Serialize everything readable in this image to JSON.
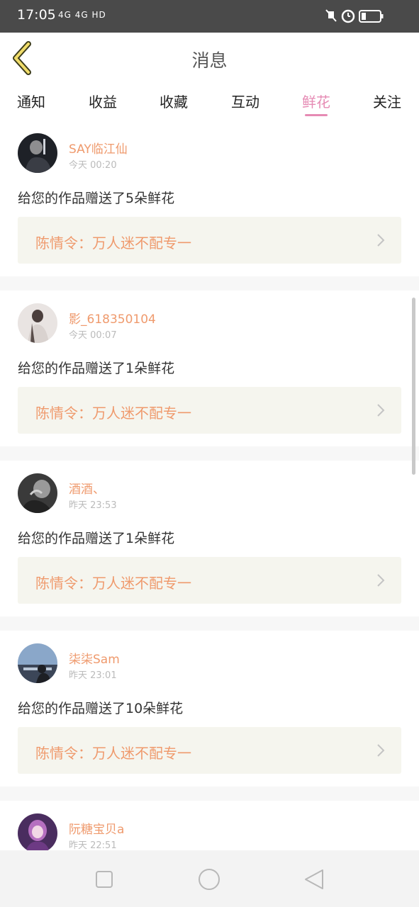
{
  "status": {
    "time": "17:05",
    "network": "4G 4G HD"
  },
  "header": {
    "title": "消息"
  },
  "tabs": [
    {
      "label": "通知"
    },
    {
      "label": "收益"
    },
    {
      "label": "收藏"
    },
    {
      "label": "互动"
    },
    {
      "label": "鲜花",
      "active": true
    },
    {
      "label": "关注"
    }
  ],
  "colors": {
    "accent": "#e68bb4",
    "name": "#ef9a6d",
    "link_bg": "#f5f5ee"
  },
  "items": [
    {
      "name": "SAY临江仙",
      "time": "今天 00:20",
      "message": "给您的作品赠送了5朵鲜花",
      "work": "陈情令：万人迷不配专一"
    },
    {
      "name": "影_618350104",
      "time": "今天 00:07",
      "message": "给您的作品赠送了1朵鲜花",
      "work": "陈情令：万人迷不配专一"
    },
    {
      "name": "酒酒、",
      "time": "昨天 23:53",
      "message": "给您的作品赠送了1朵鲜花",
      "work": "陈情令：万人迷不配专一"
    },
    {
      "name": "柒柒Sam",
      "time": "昨天 23:01",
      "message": "给您的作品赠送了10朵鲜花",
      "work": "陈情令：万人迷不配专一"
    },
    {
      "name": "阮糖宝贝a",
      "time": "昨天 22:51",
      "message": "",
      "work": ""
    }
  ],
  "icons": {
    "back": "chevron-left-icon",
    "mute": "mute-icon",
    "alarm": "alarm-icon",
    "battery": "battery-icon",
    "nav_recent": "square-icon",
    "nav_home": "circle-icon",
    "nav_back": "triangle-back-icon"
  }
}
